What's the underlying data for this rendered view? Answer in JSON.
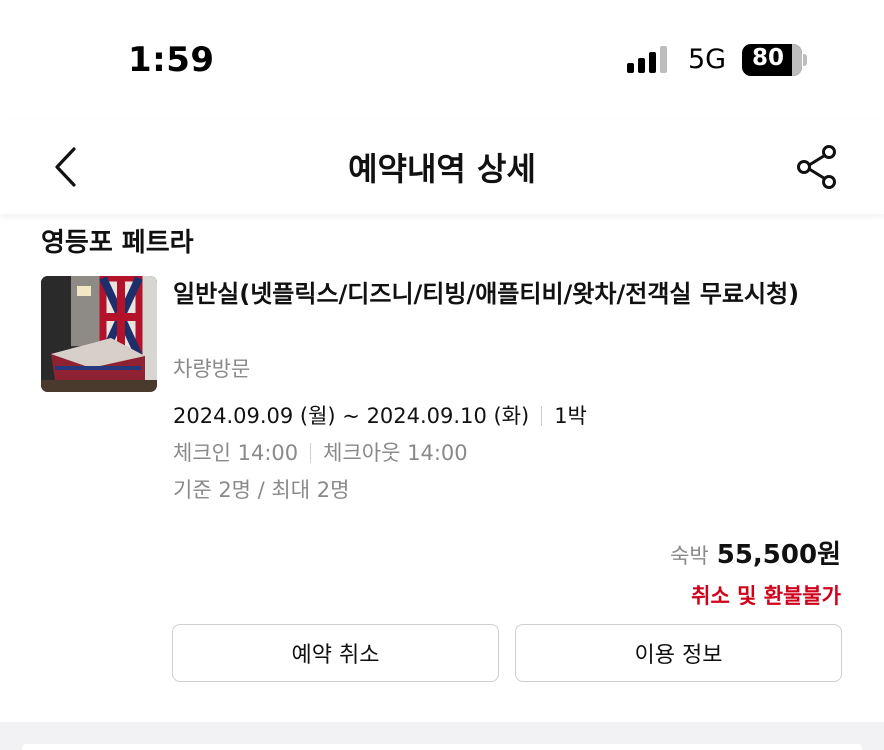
{
  "status_bar": {
    "time": "1:59",
    "network": "5G",
    "battery": "80",
    "signal_icon": "cellular-signal-icon"
  },
  "header": {
    "title": "예약내역 상세",
    "back_icon": "chevron-left-icon",
    "share_icon": "share-icon"
  },
  "reservation": {
    "hotel_name": "영등포 페트라",
    "room_name": "일반실(넷플릭스/디즈니/티빙/애플티비/왓차/전객실 무료시청)",
    "visit_type": "차량방문",
    "date_range": "2024.09.09 (월) ~ 2024.09.10 (화)",
    "nights": "1박",
    "check_in": "체크인 14:00",
    "check_out": "체크아웃 14:00",
    "occupancy": "기준 2명 / 최대 2명",
    "price_label": "숙박",
    "price": "55,500원",
    "refund_policy": "취소 및 환불불가"
  },
  "buttons": {
    "cancel": "예약 취소",
    "info": "이용 정보"
  },
  "colors": {
    "accent_red": "#d0011b",
    "muted_text": "#8a8a8a",
    "border": "#cfcfcf"
  }
}
